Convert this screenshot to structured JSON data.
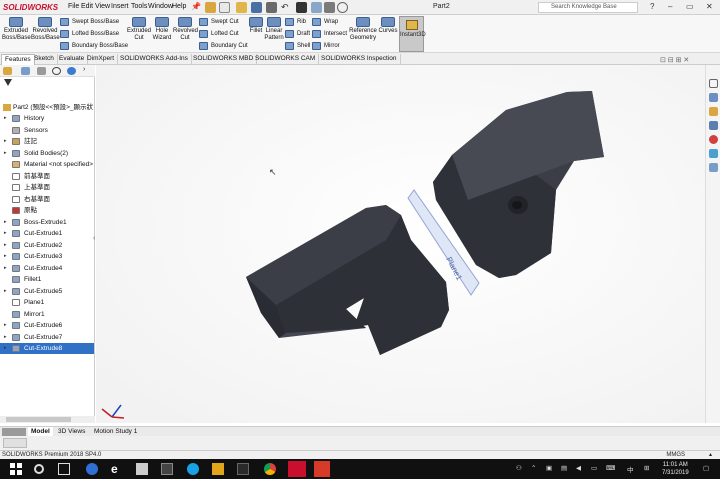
{
  "app": {
    "logo_text": "SOLIDWORKS",
    "menu": [
      "File",
      "Edit",
      "View",
      "Insert",
      "Tools",
      "Window",
      "Help"
    ],
    "doc_title": "Part2",
    "search_placeholder": "Search Knowledge Base",
    "window_controls": [
      "?",
      "–",
      "▭",
      "✕"
    ]
  },
  "ribbon": {
    "extruded_boss": "Extruded Boss/Base",
    "revolved_boss": "Revolved Boss/Base",
    "swept_boss": "Swept Boss/Base",
    "lofted_boss": "Lofted Boss/Base",
    "boundary_boss": "Boundary Boss/Base",
    "extruded_cut": "Extruded Cut",
    "hole_wizard": "Hole Wizard",
    "revolved_cut": "Revolved Cut",
    "swept_cut": "Swept Cut",
    "lofted_cut": "Lofted Cut",
    "boundary_cut": "Boundary Cut",
    "fillet": "Fillet",
    "linear_pattern": "Linear Pattern",
    "rib": "Rib",
    "draft": "Draft",
    "shell": "Shell",
    "wrap": "Wrap",
    "intersect": "Intersect",
    "mirror": "Mirror",
    "reference_geometry": "Reference Geometry",
    "curves": "Curves",
    "instant3d": "Instant3D"
  },
  "tabs": [
    "Features",
    "Sketch",
    "Evaluate",
    "DimXpert",
    "SOLIDWORKS Add-Ins",
    "SOLIDWORKS MBD",
    "SOLIDWORKS CAM",
    "SOLIDWORKS Inspection"
  ],
  "tree": {
    "root": "Part2  (預設<<預設>_顯示狀",
    "items": [
      {
        "label": "History",
        "arrow": "▸",
        "color": "#8aa6c8"
      },
      {
        "label": "Sensors",
        "arrow": "",
        "color": "#b0b0b0"
      },
      {
        "label": "註記",
        "arrow": "▸",
        "color": "#c8a060"
      },
      {
        "label": "Solid Bodies(2)",
        "arrow": "▸",
        "color": "#8aa6c8"
      },
      {
        "label": "Material <not specified>",
        "arrow": "",
        "color": "#d8b070"
      },
      {
        "label": "前基準面",
        "arrow": "",
        "color": "#ffffff"
      },
      {
        "label": "上基準面",
        "arrow": "",
        "color": "#ffffff"
      },
      {
        "label": "右基準面",
        "arrow": "",
        "color": "#ffffff"
      },
      {
        "label": "原點",
        "arrow": "",
        "color": "#cc3333"
      },
      {
        "label": "Boss-Extrude1",
        "arrow": "▸",
        "color": "#8aa6c8"
      },
      {
        "label": "Cut-Extrude1",
        "arrow": "▸",
        "color": "#8aa6c8"
      },
      {
        "label": "Cut-Extrude2",
        "arrow": "▸",
        "color": "#8aa6c8"
      },
      {
        "label": "Cut-Extrude3",
        "arrow": "▸",
        "color": "#8aa6c8"
      },
      {
        "label": "Cut-Extrude4",
        "arrow": "▸",
        "color": "#8aa6c8"
      },
      {
        "label": "Fillet1",
        "arrow": "",
        "color": "#8aa6c8"
      },
      {
        "label": "Cut-Extrude5",
        "arrow": "▸",
        "color": "#8aa6c8"
      },
      {
        "label": "Plane1",
        "arrow": "",
        "color": "#ffffff"
      },
      {
        "label": "Mirror1",
        "arrow": "",
        "color": "#8aa6c8"
      },
      {
        "label": "Cut-Extrude6",
        "arrow": "▸",
        "color": "#8aa6c8"
      },
      {
        "label": "Cut-Extrude7",
        "arrow": "▸",
        "color": "#8aa6c8"
      },
      {
        "label": "Cut-Extrude8",
        "arrow": "▸",
        "color": "#8aa6c8"
      }
    ]
  },
  "viewport": {
    "plane_label": "Plane1"
  },
  "bottom_tabs": [
    "Model",
    "3D Views",
    "Motion Study 1"
  ],
  "status": {
    "text": "SOLIDWORKS Premium 2018 SP4.0",
    "units": "MMGS",
    "arrow": "▴"
  },
  "taskbar": {
    "tray_lang": "中",
    "time": "11:01 AM",
    "date": "7/31/2019"
  },
  "colors": {
    "accent": "#3170c7",
    "model_body": "#3b3e47",
    "taskbar": "#101010"
  }
}
